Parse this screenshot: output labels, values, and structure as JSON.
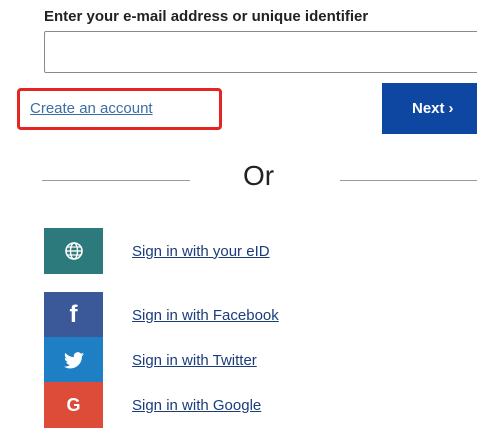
{
  "form": {
    "email_label": "Enter your e-mail address or unique identifier",
    "email_value": "",
    "create_account_label": "Create an account",
    "next_label": "Next",
    "next_chevron": "›",
    "or_label": "Or"
  },
  "social": [
    {
      "label": "Sign in with your eID",
      "icon": "globe-icon",
      "color": "#2c7a7b"
    },
    {
      "label": "Sign in with Facebook",
      "icon": "facebook-icon",
      "glyph": "f",
      "color": "#3b5998"
    },
    {
      "label": "Sign in with Twitter",
      "icon": "twitter-icon",
      "color": "#1f7fc4"
    },
    {
      "label": "Sign in with Google",
      "icon": "google-icon",
      "glyph": "G",
      "color": "#dd4b39"
    }
  ],
  "colors": {
    "highlight": "#e52521",
    "next_button": "#0d47a1",
    "link": "#3a6ea5"
  }
}
